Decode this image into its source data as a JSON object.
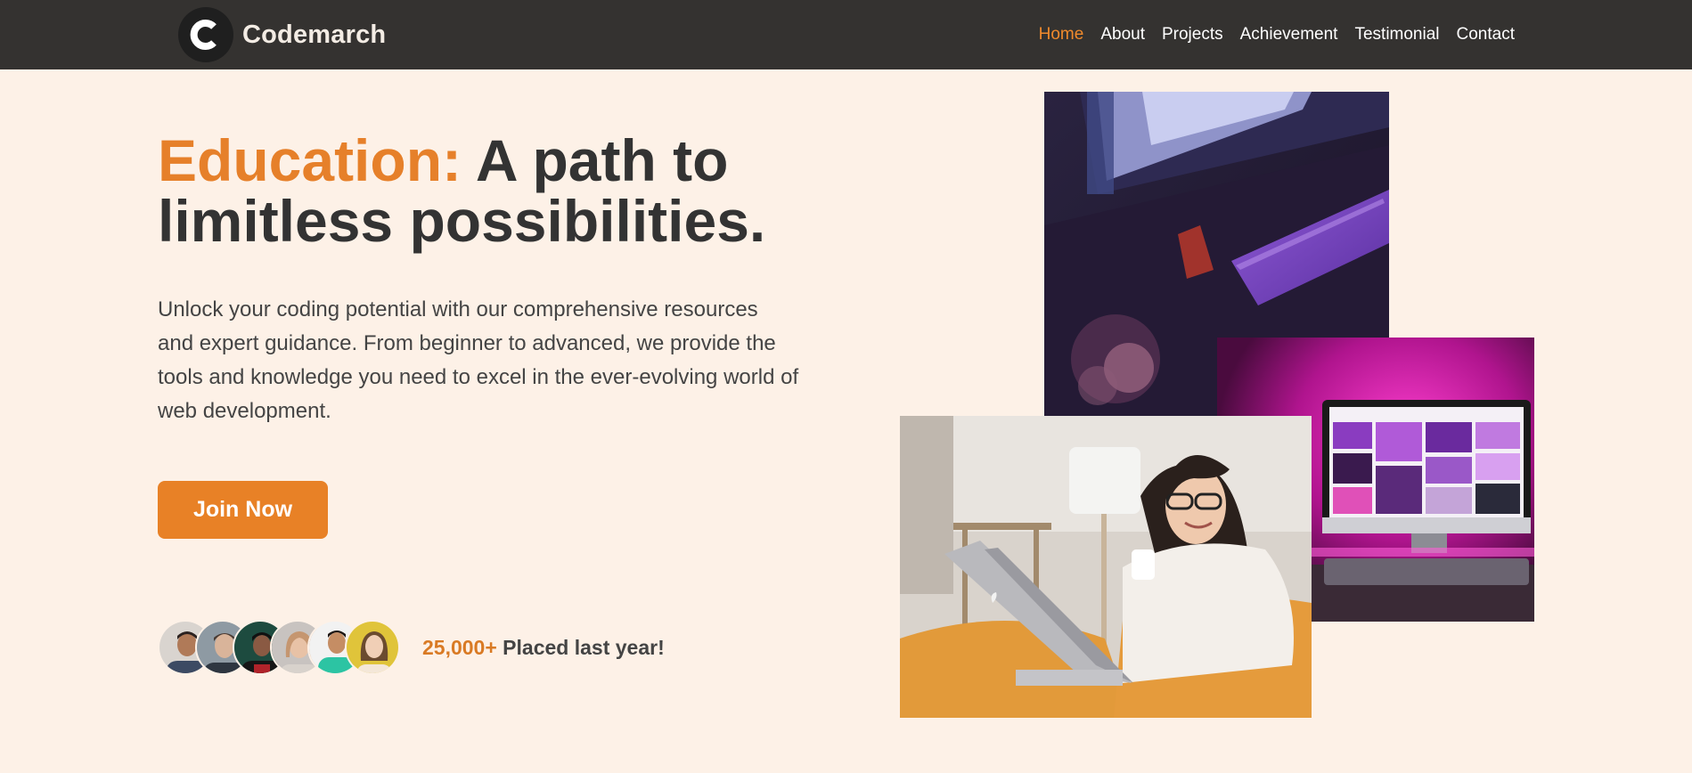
{
  "nav": {
    "brand": "Codemarch",
    "logo_letter": "C",
    "items": [
      {
        "label": "Home",
        "active": true
      },
      {
        "label": "About",
        "active": false
      },
      {
        "label": "Projects",
        "active": false
      },
      {
        "label": "Achievement",
        "active": false
      },
      {
        "label": "Testimonial",
        "active": false
      },
      {
        "label": "Contact",
        "active": false
      }
    ]
  },
  "hero": {
    "heading_accent": "Education:",
    "heading_rest": " A path to limitless possibilities.",
    "description": "Unlock your coding potential with our comprehensive resources and expert guidance. From beginner to advanced, we provide the tools and knowledge you need to excel in the ever-evolving world of web development.",
    "cta_label": "Join Now"
  },
  "stats": {
    "count": "25,000+",
    "label": " Placed last year!"
  },
  "colors": {
    "accent": "#e6802a",
    "nav_bg": "#343230",
    "page_bg": "#fdf1e7"
  }
}
